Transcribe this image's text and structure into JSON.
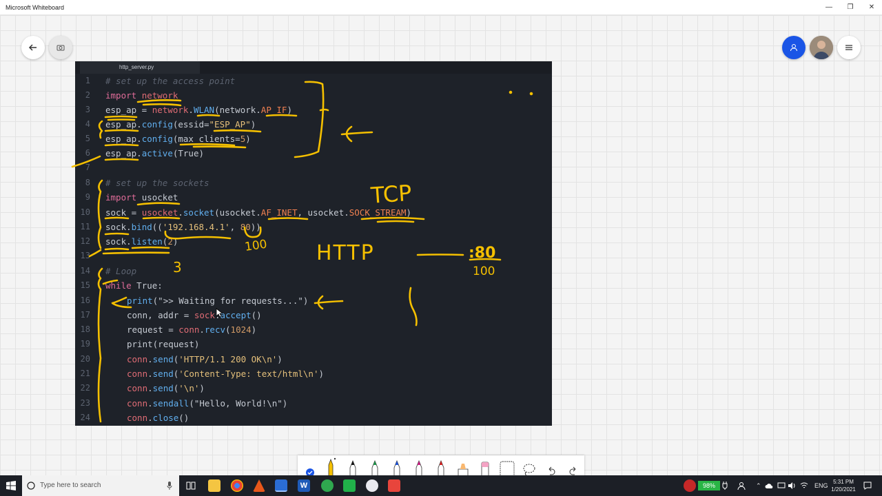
{
  "window": {
    "title": "Microsoft Whiteboard",
    "minimize_icon": "minimize-icon",
    "maximize_icon": "restore-icon",
    "close_icon": "close-icon"
  },
  "canvas_controls": {
    "back_icon": "arrow-left-icon",
    "settings_icon": "camera-rotate-icon",
    "invite_icon": "person-icon",
    "menu_icon": "hamburger-menu-icon"
  },
  "editor": {
    "tab_label": "http_server.py",
    "lines": [
      {
        "n": "1"
      },
      {
        "n": "2"
      },
      {
        "n": "3"
      },
      {
        "n": "4"
      },
      {
        "n": "5"
      },
      {
        "n": "6"
      },
      {
        "n": "7"
      },
      {
        "n": "8"
      },
      {
        "n": "9"
      },
      {
        "n": "10"
      },
      {
        "n": "11"
      },
      {
        "n": "12"
      },
      {
        "n": "13"
      },
      {
        "n": "14"
      },
      {
        "n": "15"
      },
      {
        "n": "16"
      },
      {
        "n": "17"
      },
      {
        "n": "18"
      },
      {
        "n": "19"
      },
      {
        "n": "20"
      },
      {
        "n": "21"
      },
      {
        "n": "22"
      },
      {
        "n": "23"
      },
      {
        "n": "24"
      }
    ],
    "code": {
      "l1": "# set up the access point",
      "l2_kw": "import",
      "l2_mod": "network",
      "l3_a": "esp_ap",
      "l3_b": " = ",
      "l3_c": "network",
      "l3_d": ".",
      "l3_e": "WLAN",
      "l3_f": "(network.",
      "l3_g": "AP_IF",
      "l3_h": ")",
      "l4_a": "esp_ap",
      "l4_b": ".",
      "l4_c": "config",
      "l4_d": "(essid=",
      "l4_e": "\"ESP_AP\"",
      "l4_f": ")",
      "l5_a": "esp_ap",
      "l5_b": ".",
      "l5_c": "config",
      "l5_d": "(max_clients=",
      "l5_e": "5",
      "l5_f": ")",
      "l6_a": "esp_ap",
      "l6_b": ".",
      "l6_c": "active",
      "l6_d": "(True)",
      "l8": "# set up the sockets",
      "l9_kw": "import",
      "l9_mod": "usocket",
      "l10_a": "sock",
      "l10_b": " = ",
      "l10_c": "usocket",
      "l10_d": ".",
      "l10_e": "socket",
      "l10_f": "(usocket.",
      "l10_g": "AF_INET",
      "l10_h": ", usocket.",
      "l10_i": "SOCK_STREAM",
      "l10_j": ")",
      "l11_a": "sock",
      "l11_b": ".",
      "l11_c": "bind",
      "l11_d": "((",
      "l11_e": "'192.168.4.1'",
      "l11_f": ", ",
      "l11_g": "80",
      "l11_h": "))",
      "l12_a": "sock",
      "l12_b": ".",
      "l12_c": "listen",
      "l12_d": "(",
      "l12_e": "2",
      "l12_f": ")",
      "l14": "# Loop",
      "l15_kw": "while",
      "l15_b": " True:",
      "l16_a": "print",
      "l16_b": "(",
      "l16_c": "\">> Waiting for requests...\"",
      "l16_d": ")",
      "l17_a": "conn, addr = ",
      "l17_b": "sock",
      "l17_c": ".",
      "l17_d": "accept",
      "l17_e": "()",
      "l18_a": "request = ",
      "l18_b": "conn",
      "l18_c": ".",
      "l18_d": "recv",
      "l18_e": "(",
      "l18_f": "1024",
      "l18_g": ")",
      "l19_a": "print",
      "l19_b": "(request)",
      "l20_a": "conn",
      "l20_b": ".",
      "l20_c": "send",
      "l20_d": "(",
      "l20_e": "'HTTP/1.1 200 OK\\n'",
      "l20_f": ")",
      "l21_a": "conn",
      "l21_b": ".",
      "l21_c": "send",
      "l21_d": "(",
      "l21_e": "'Content-Type: text/html\\n'",
      "l21_f": ")",
      "l22_a": "conn",
      "l22_b": ".",
      "l22_c": "send",
      "l22_d": "(",
      "l22_e": "'\\n'",
      "l22_f": ")",
      "l23_a": "conn",
      "l23_b": ".",
      "l23_c": "sendall",
      "l23_d": "(",
      "l23_e": "\"Hello, World!\\n\"",
      "l23_f": ")",
      "l24_a": "conn",
      "l24_b": ".",
      "l24_c": "close",
      "l24_d": "()"
    }
  },
  "annotations": {
    "tcp": "TCP",
    "http": "HTTP",
    "port": ":80",
    "num_100_a": "100",
    "num_100_b": "100",
    "num_3": "3",
    "ink_color": "#f5c000"
  },
  "toolbar": {
    "tools": [
      "checkmark-icon",
      "yellow-pen-icon",
      "black-pen-icon",
      "green-pen-icon",
      "blue-pen-icon",
      "magenta-pen-icon",
      "red-pen-icon",
      "highlighter-icon",
      "eraser-icon",
      "ruler-icon",
      "lasso-icon",
      "undo-icon",
      "redo-icon"
    ]
  },
  "taskbar": {
    "search_placeholder": "Type here to search",
    "battery": "98%",
    "language": "ENG",
    "time": "5:31 PM",
    "date": "1/20/2021"
  }
}
